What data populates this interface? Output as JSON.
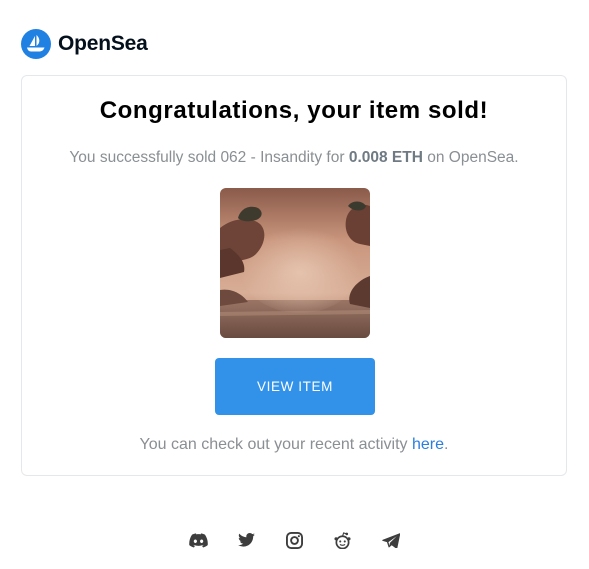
{
  "brand": {
    "name": "OpenSea",
    "color": "#2081e2"
  },
  "email": {
    "title": "Congratulations, your item sold!",
    "sold_prefix": "You successfully sold 062 - Insandity for ",
    "price": "0.008 ETH",
    "sold_suffix": " on OpenSea.",
    "image_alt": "062 - Insandity",
    "button_label": "VIEW ITEM",
    "activity_prefix": "You can check out your recent activity ",
    "activity_link": "here",
    "activity_suffix": "."
  },
  "social_icons": [
    "discord-icon",
    "twitter-icon",
    "instagram-icon",
    "reddit-icon",
    "telegram-icon"
  ],
  "colors": {
    "accent": "#3291e9",
    "link": "#2a7ee0",
    "muted_text": "#8a8f93"
  }
}
